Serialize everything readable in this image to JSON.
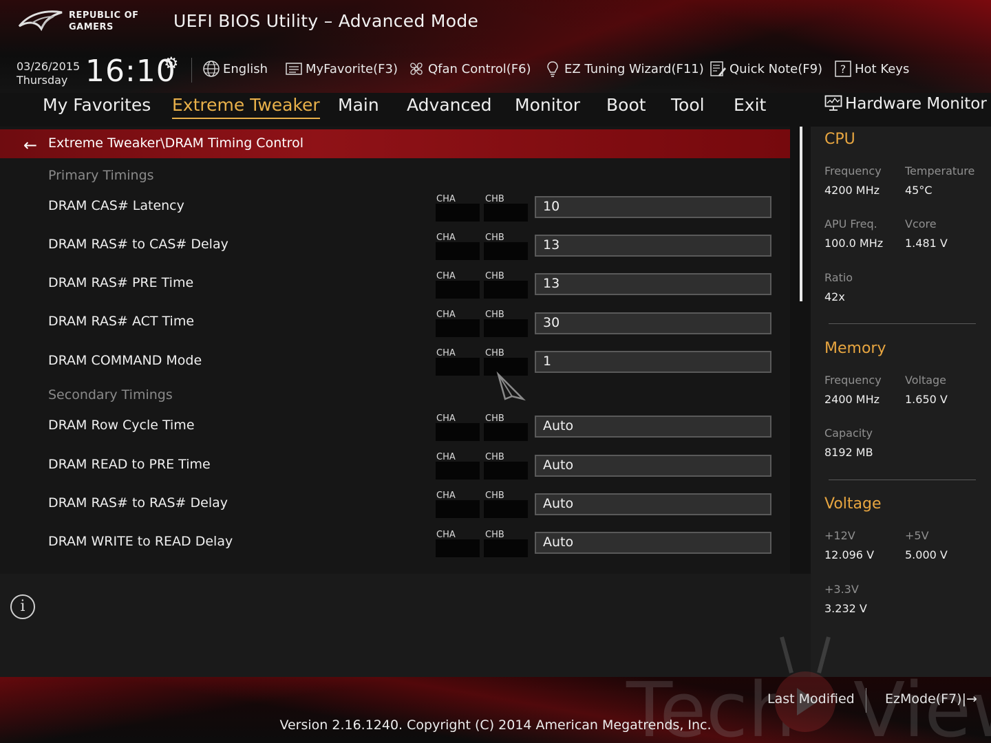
{
  "header": {
    "brand_line1": "REPUBLIC OF",
    "brand_line2": "GAMERS",
    "title": "UEFI BIOS Utility – Advanced Mode",
    "date": "03/26/2015",
    "weekday": "Thursday",
    "time": "16:10"
  },
  "toolbar": {
    "language": "English",
    "my_favorite": "MyFavorite(F3)",
    "qfan": "Qfan Control(F6)",
    "ez_tuning": "EZ Tuning Wizard(F11)",
    "quick_note": "Quick Note(F9)",
    "hot_keys": "Hot Keys"
  },
  "tabs": [
    "My Favorites",
    "Extreme Tweaker",
    "Main",
    "Advanced",
    "Monitor",
    "Boot",
    "Tool",
    "Exit"
  ],
  "active_tab": "Extreme Tweaker",
  "breadcrumb": "Extreme Tweaker\\DRAM Timing Control",
  "channels": {
    "a": "CHA",
    "b": "CHB"
  },
  "primary_heading": "Primary Timings",
  "secondary_heading": "Secondary Timings",
  "primary_rows": [
    {
      "label": "DRAM CAS# Latency",
      "value": "10"
    },
    {
      "label": "DRAM RAS# to CAS# Delay",
      "value": "13"
    },
    {
      "label": "DRAM RAS# PRE Time",
      "value": "13"
    },
    {
      "label": "DRAM RAS# ACT Time",
      "value": "30"
    },
    {
      "label": "DRAM COMMAND Mode",
      "value": "1"
    }
  ],
  "secondary_rows": [
    {
      "label": "DRAM Row Cycle Time",
      "value": "Auto"
    },
    {
      "label": "DRAM READ to PRE Time",
      "value": "Auto"
    },
    {
      "label": "DRAM RAS# to RAS# Delay",
      "value": "Auto"
    },
    {
      "label": "DRAM WRITE to READ Delay",
      "value": "Auto"
    }
  ],
  "hardware_monitor": {
    "title": "Hardware Monitor",
    "cpu": {
      "heading": "CPU",
      "frequency_label": "Frequency",
      "frequency": "4200 MHz",
      "temperature_label": "Temperature",
      "temperature": "45°C",
      "apu_label": "APU Freq.",
      "apu": "100.0 MHz",
      "vcore_label": "Vcore",
      "vcore": "1.481 V",
      "ratio_label": "Ratio",
      "ratio": "42x"
    },
    "memory": {
      "heading": "Memory",
      "frequency_label": "Frequency",
      "frequency": "2400 MHz",
      "voltage_label": "Voltage",
      "voltage": "1.650 V",
      "capacity_label": "Capacity",
      "capacity": "8192 MB"
    },
    "voltage": {
      "heading": "Voltage",
      "v12_label": "+12V",
      "v12": "12.096 V",
      "v5_label": "+5V",
      "v5": "5.000 V",
      "v33_label": "+3.3V",
      "v33": "3.232 V"
    }
  },
  "footer": {
    "last_modified": "Last Modified",
    "ez_mode": "EzMode(F7)|→",
    "copyright": "Version 2.16.1240. Copyright (C) 2014 American Megatrends, Inc."
  },
  "colors": {
    "accent": "#e8b04a",
    "section": "#e8a640",
    "breadcrumb_bar": "#8f1217"
  }
}
